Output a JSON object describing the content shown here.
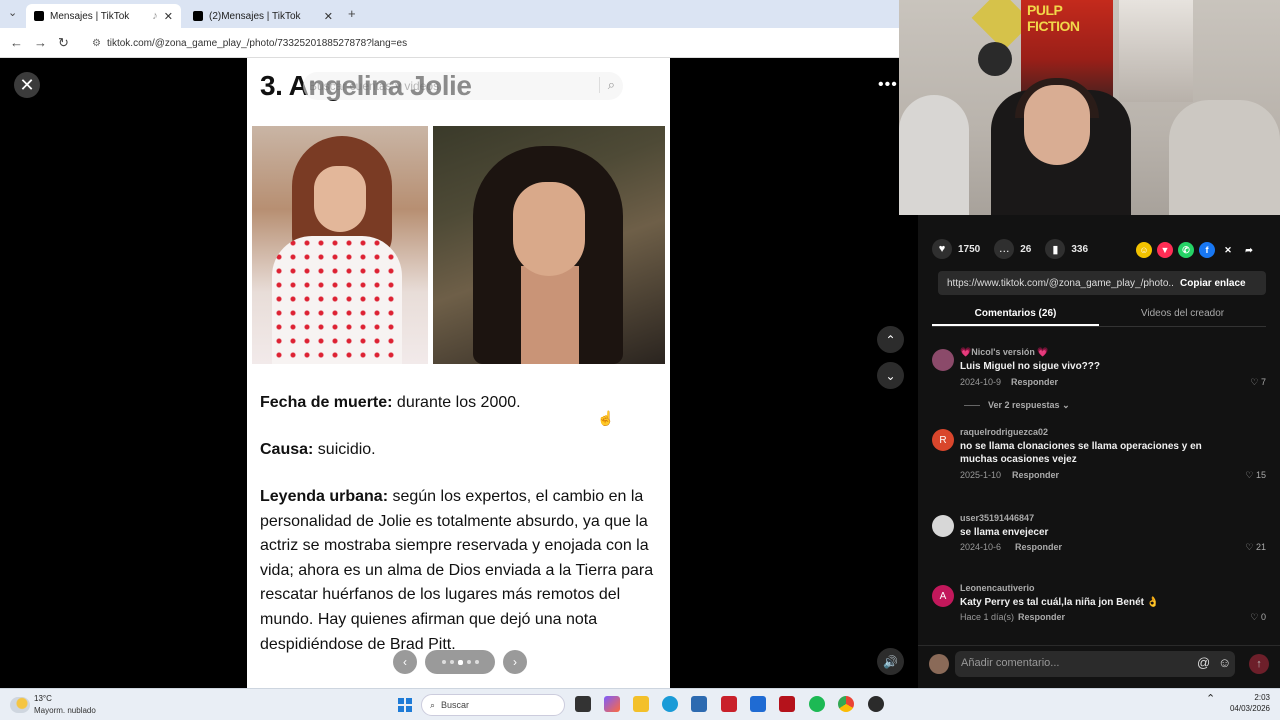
{
  "browser": {
    "tabs": [
      {
        "title": "Mensajes | TikTok",
        "active": true
      },
      {
        "title": "(2)Mensajes | TikTok",
        "active": false
      }
    ],
    "url": "tiktok.com/@zona_game_play_/photo/7332520188527878?lang=es"
  },
  "slide": {
    "title": "3. Angelina Jolie",
    "search_placeholder": "Buscar cuentas y videos",
    "death_label": "Fecha de muerte:",
    "death_value": " durante los 2000.",
    "cause_label": "Causa:",
    "cause_value": " suicidio.",
    "legend_label": "Leyenda urbana:",
    "legend_value": " según los expertos, el cambio en la personalidad de Jolie es totalmente absurdo, ya que la actriz se mostraba siempre reservada y enojada con la vida; ahora es un alma de Dios enviada a la Tierra para rescatar huérfanos de los lugares más remotos del mundo. Hay quienes afirman que dejó una nota despidiéndose de Brad Pitt.",
    "page_dots": 5,
    "current_dot": 3
  },
  "webcam": {
    "poster_text": "PULP FICTION"
  },
  "panel": {
    "likes": "1750",
    "comments_count": "26",
    "saves": "336",
    "link": "https://www.tiktok.com/@zona_game_play_/photo...",
    "copy_label": "Copiar enlace",
    "tab_comments": "Comentarios (26)",
    "tab_creator": "Videos del creador",
    "reply_label": "Responder",
    "view_replies": "Ver 2 respuestas",
    "composer_placeholder": "Añadir comentario...",
    "comment_list": [
      {
        "user": "💗Nicol's versión 💗",
        "text": "Luis Miguel no sigue vivo???",
        "date": "2024-10-9",
        "likes": "7",
        "avatar_letter": "",
        "avatar_color": "#8b4a6a"
      },
      {
        "user": "raquelrodriguezca02",
        "text": "no se llama clonaciones se llama operaciones y en muchas ocasiones vejez",
        "date": "2025-1-10",
        "likes": "15",
        "avatar_letter": "R",
        "avatar_color": "#d9462c"
      },
      {
        "user": "user35191446847",
        "text": "se llama envejecer",
        "date": "2024-10-6",
        "likes": "21",
        "avatar_letter": "",
        "avatar_color": "#d7d7d7"
      },
      {
        "user": "Leonencautiverio",
        "text": "Katy Perry es tal cuál,la niña jon Benét 👌",
        "date": "Hace 1 día(s)",
        "likes": "0",
        "avatar_letter": "A",
        "avatar_color": "#c2185b"
      }
    ]
  },
  "taskbar": {
    "temp": "13°C",
    "weather": "Mayorm. nublado",
    "search": "Buscar",
    "time": "2:03",
    "date": "04/03/2026"
  }
}
